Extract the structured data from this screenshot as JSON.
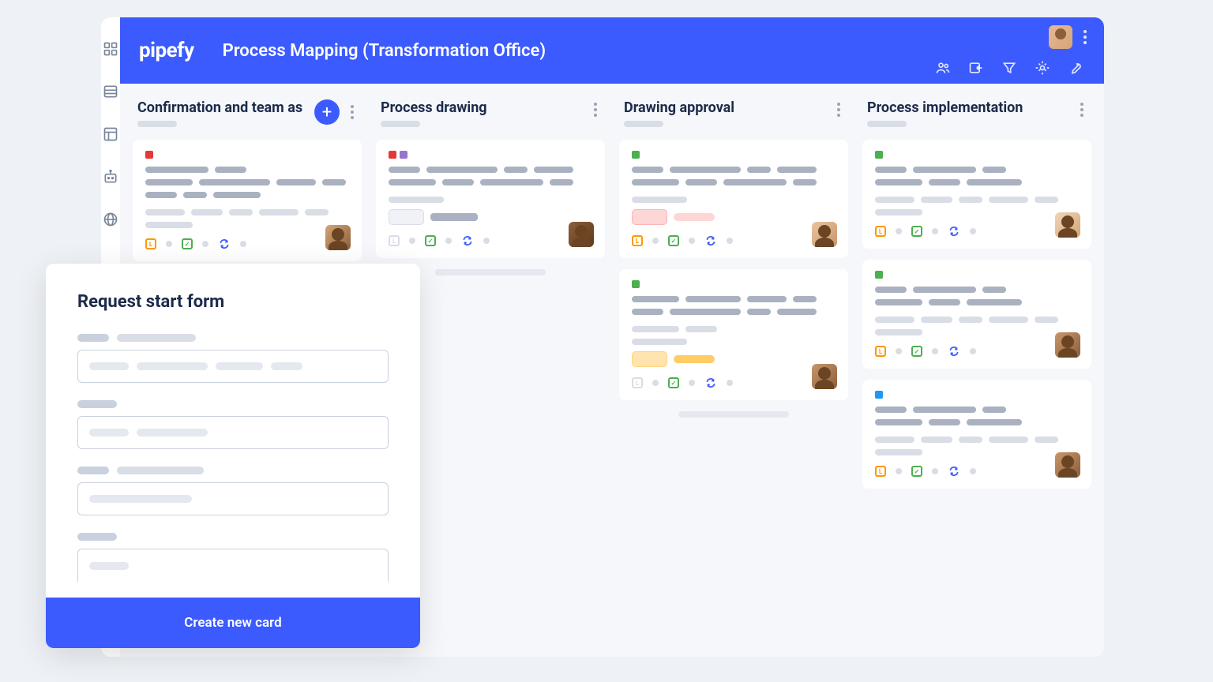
{
  "brand": "pipefy",
  "header": {
    "title": "Process Mapping (Transformation Office)"
  },
  "columns": [
    {
      "title": "Confirmation and team as"
    },
    {
      "title": "Process drawing"
    },
    {
      "title": "Drawing approval"
    },
    {
      "title": "Process implementation"
    }
  ],
  "modal": {
    "title": "Request start form",
    "submit": "Create new card"
  }
}
